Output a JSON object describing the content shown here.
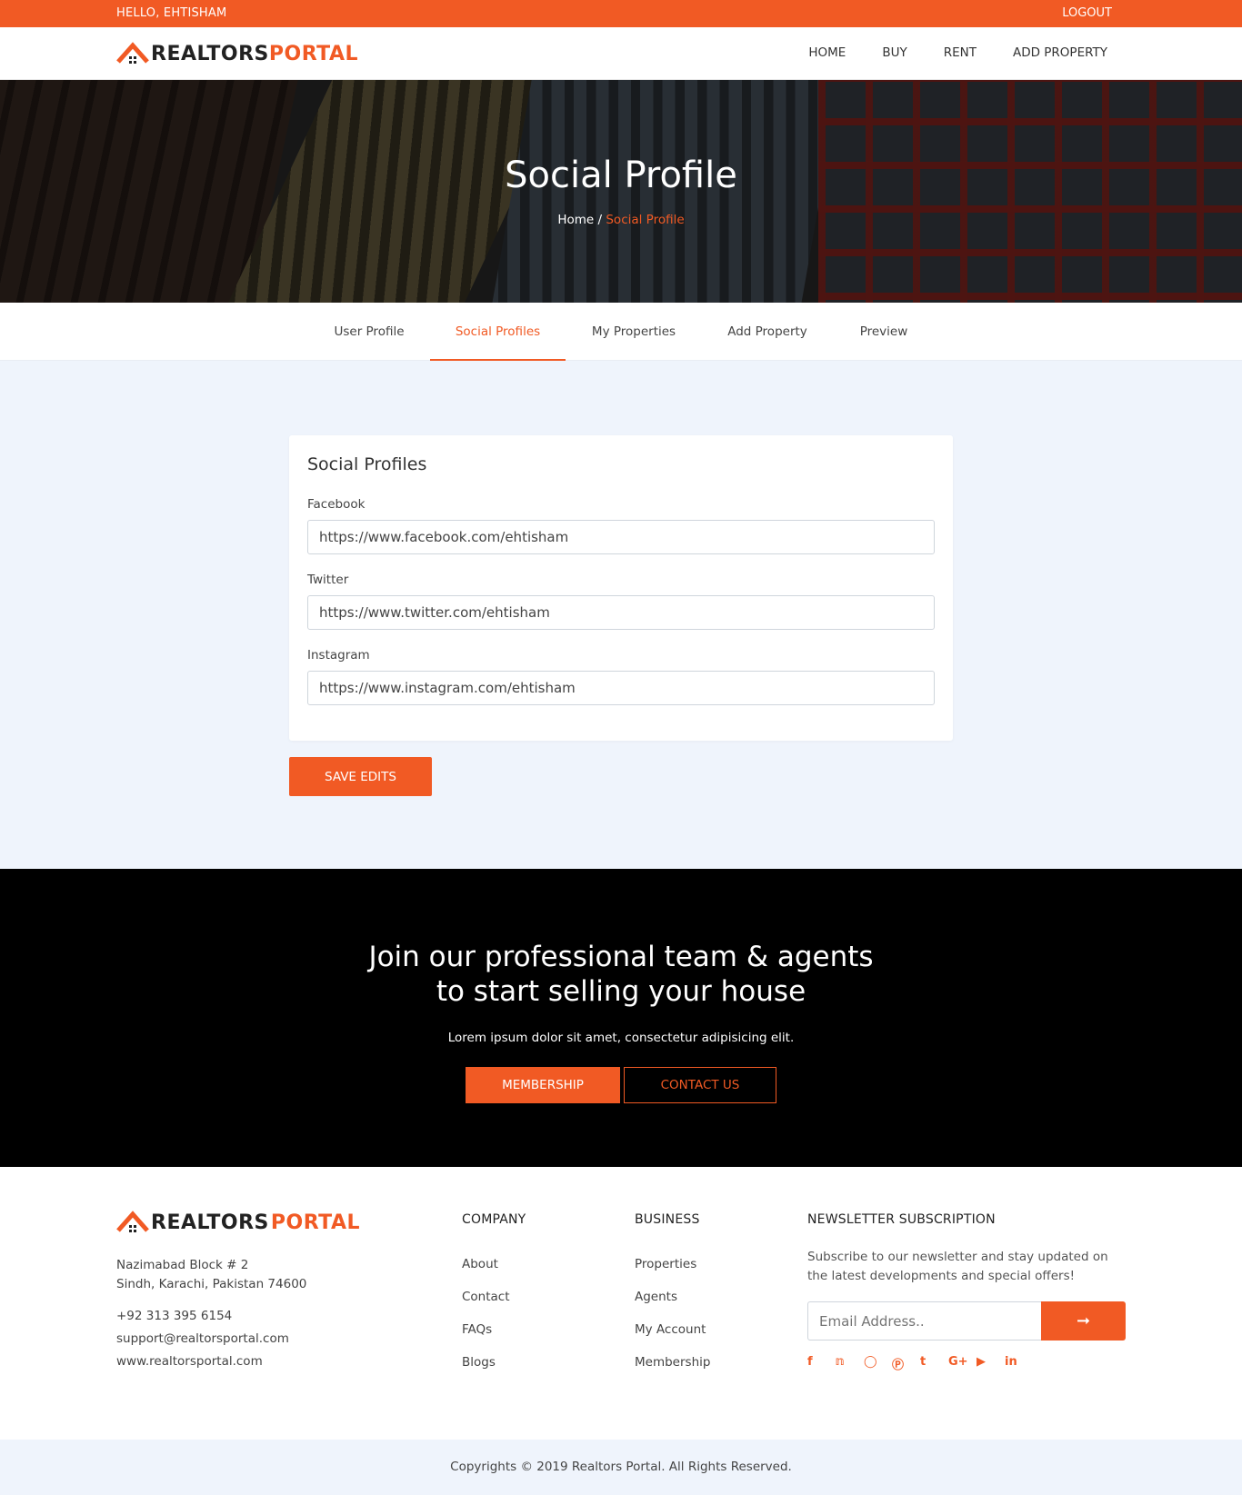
{
  "topbar": {
    "greeting": "HELLO, EHTISHAM",
    "logout": "LOGOUT"
  },
  "brand": {
    "part1": "REALTORS",
    "part2": "PORTAL",
    "accent": "#f15a24"
  },
  "nav": [
    "HOME",
    "BUY",
    "RENT",
    "ADD PROPERTY"
  ],
  "hero": {
    "title": "Social Profile",
    "crumb_home": "Home /",
    "crumb_current": "Social Profile"
  },
  "tabs": [
    "User Profile",
    "Social Profiles",
    "My Properties",
    "Add Property",
    "Preview"
  ],
  "active_tab": "Social Profiles",
  "form": {
    "title": "Social Profiles",
    "fields": [
      {
        "label": "Facebook",
        "value": "https://www.facebook.com/ehtisham"
      },
      {
        "label": "Twitter",
        "value": "https://www.twitter.com/ehtisham"
      },
      {
        "label": "Instagram",
        "value": "https://www.instagram.com/ehtisham"
      }
    ],
    "save_label": "SAVE EDITS"
  },
  "cta": {
    "line1": "Join our professional team & agents",
    "line2": "to start selling your house",
    "text": "Lorem ipsum dolor sit amet, consectetur adipisicing elit.",
    "membership": "MEMBERSHIP",
    "contact": "CONTACT US"
  },
  "footer": {
    "address1": "Nazimabad Block # 2",
    "address2": "Sindh, Karachi, Pakistan 74600",
    "phone": "+92 313 395 6154",
    "email": "support@realtorsportal.com",
    "site": "www.realtorsportal.com",
    "company_title": "COMPANY",
    "company_links": [
      "About",
      "Contact",
      "FAQs",
      "Blogs"
    ],
    "business_title": "BUSINESS",
    "business_links": [
      "Properties",
      "Agents",
      "My Account",
      "Membership"
    ],
    "newsletter_title": "NEWSLETTER SUBSCRIPTION",
    "newsletter_text": "Subscribe to our newsletter and stay updated on the latest developments and special offers!",
    "email_placeholder": "Email Address..",
    "socials": [
      "facebook-icon",
      "twitter-icon",
      "instagram-icon",
      "pinterest-icon",
      "tumblr-icon",
      "google-plus-icon",
      "youtube-icon",
      "linkedin-icon"
    ]
  },
  "copyright": "Copyrights © 2019 Realtors Portal. All Rights Reserved."
}
